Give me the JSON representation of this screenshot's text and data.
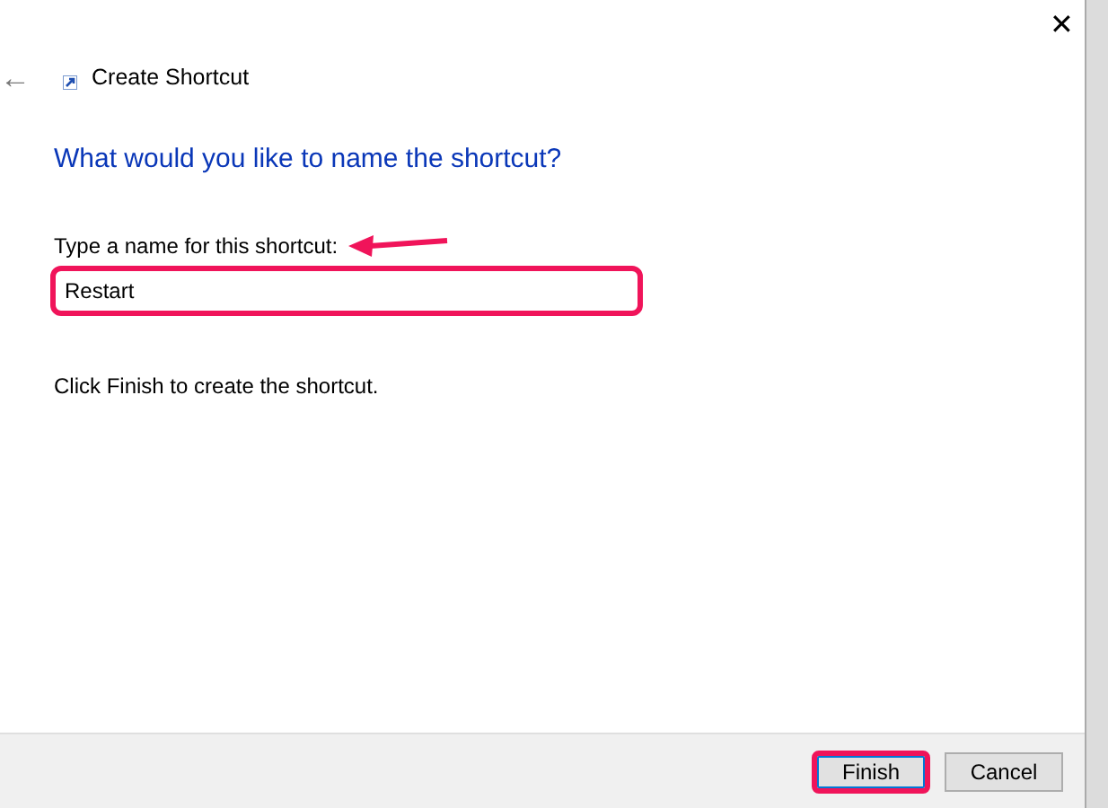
{
  "window": {
    "title": "Create Shortcut",
    "close": "✕",
    "back": "←"
  },
  "heading": "What would you like to name the shortcut?",
  "name_field": {
    "label": "Type a name for this shortcut:",
    "value": "Restart",
    "highlighted": true,
    "pointer_arrow": true
  },
  "hint": "Click Finish to create the shortcut.",
  "buttons": [
    {
      "label": "Finish",
      "highlighted": true,
      "default": true
    },
    {
      "label": "Cancel",
      "highlighted": false,
      "default": false
    }
  ]
}
